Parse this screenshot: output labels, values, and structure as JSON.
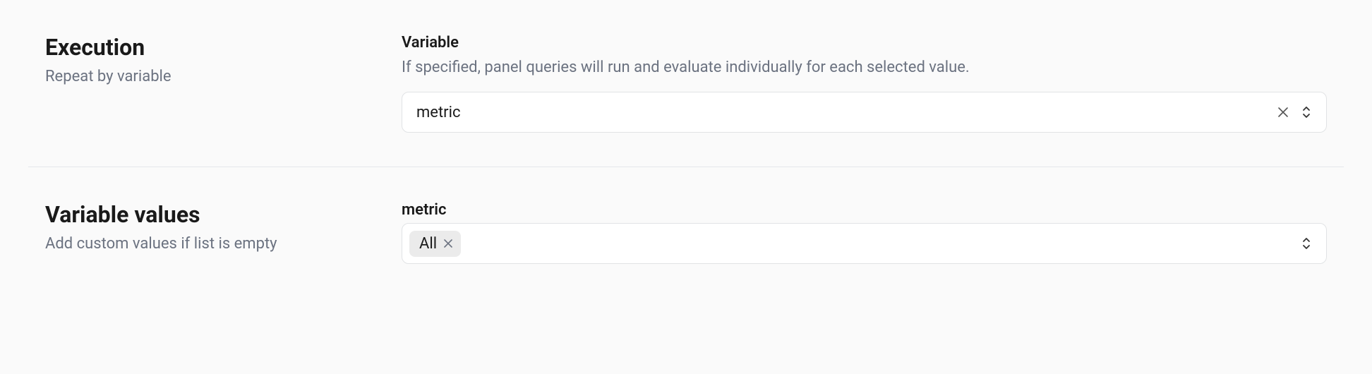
{
  "execution": {
    "title": "Execution",
    "subtitle": "Repeat by variable",
    "field_label": "Variable",
    "field_description": "If specified, panel queries will run and evaluate individually for each selected value.",
    "select_value": "metric"
  },
  "variable_values": {
    "title": "Variable values",
    "subtitle": "Add custom values if list is empty",
    "field_label": "metric",
    "chips": [
      "All"
    ]
  }
}
